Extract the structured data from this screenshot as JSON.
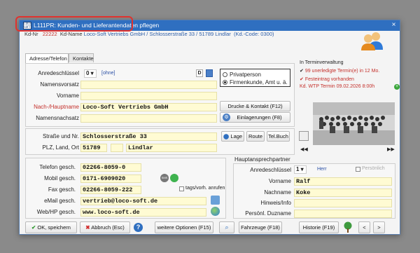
{
  "window": {
    "title": "L111PR: Kunden- und Lieferantendaten pflegen",
    "icon_text": "LOCO SOFT",
    "close_label": "×"
  },
  "header": {
    "prefix": "Kd-Nr",
    "number": "22222",
    "label": "Kd-Name",
    "name": "Loco-Soft Vertriebs GmbH / Schlosserstraße 33 / 51789 Lindlar",
    "code": "(Kd.-Code: 0300)"
  },
  "tabs": [
    {
      "label": "Adresse/Telefon"
    },
    {
      "label": "Kontakte"
    }
  ],
  "name_section": {
    "anrede_label": "Anredeschlüssel",
    "anrede_value": "0",
    "anrede_text": "[ohne]",
    "d_button": "D",
    "vorsatz_label": "Namensvorsatz",
    "vorsatz_value": "",
    "vorname_label": "Vorname",
    "vorname_value": "",
    "nachname_label": "Nach-/Hauptname",
    "nachname_value": "Loco-Soft Vertriebs GmbH",
    "nachsatz_label": "Namensnachsatz",
    "nachsatz_value": "",
    "privat_label": "Privatperson",
    "firma_label": "Firmenkunde, Amt u. ä.",
    "drucke_button": "Drucke & Kontakt (F12)",
    "einlagerungen_button": "Einlagerungen (F8)"
  },
  "termin": {
    "title": "In Terminverwaltung",
    "line1": "99 unerledigte Termin(e) in 12 Mo.",
    "line2": "Festeintrag vorhanden",
    "line3": "Kd. WTP Termin 09.02.2026  8:00h"
  },
  "address": {
    "strasse_label": "Straße und Nr.",
    "strasse_value": "Schlosserstraße 33",
    "lage_button": "Lage",
    "route_button": "Route",
    "telbuch_button": "Tel.Buch",
    "plz_label": "PLZ, Land, Ort",
    "plz_value": "51789",
    "land_value": "",
    "ort_value": "Lindlar"
  },
  "contact": {
    "telefon_label": "Telefon gesch.",
    "telefon_value": "02266-8059-0",
    "mobil_label": "Mobil gesch.",
    "mobil_value": "0171-6909020",
    "fax_label": "Fax gesch.",
    "fax_value": "02266-8059-222",
    "tags_label": "tags/vorh. anrufen",
    "email_label": "eMail gesch.",
    "email_value": "vertrieb@loco-soft.de",
    "web_label": "Web/HP gesch.",
    "web_value": "www.loco-soft.de",
    "sms_icon_text": "SMS"
  },
  "hauptansprech": {
    "title": "Hauptansprechpartner",
    "anrede_label": "Anredeschlüssel",
    "anrede_value": "1",
    "anrede_text": "Herr",
    "persoenlich_label": "Persönlich",
    "vorname_label": "Vorname",
    "vorname_value": "Ralf",
    "nachname_label": "Nachname",
    "nachname_value": "Koke",
    "hinweis_label": "Hinweis/Info",
    "hinweis_value": "",
    "duzname_label": "Persönl. Duzname",
    "duzname_value": ""
  },
  "nav": {
    "prev": "◀◀",
    "next": "▶▶"
  },
  "footer": {
    "ok_button": "OK, speichern",
    "abbruch_button": "Abbruch (Esc)",
    "help_icon_text": "?",
    "optionen_button": "weitere Optionen (F15)",
    "fahrzeuge_button": "Fahrzeuge (F18)",
    "historie_button": "Historie (F19)",
    "prev_button": "<",
    "next_button": ">"
  },
  "colors": {
    "titlebar": "#2f6fc0",
    "field_bg": "#fffbd3",
    "accent_red": "#c4302b",
    "highlight_box": "#e0322e"
  }
}
